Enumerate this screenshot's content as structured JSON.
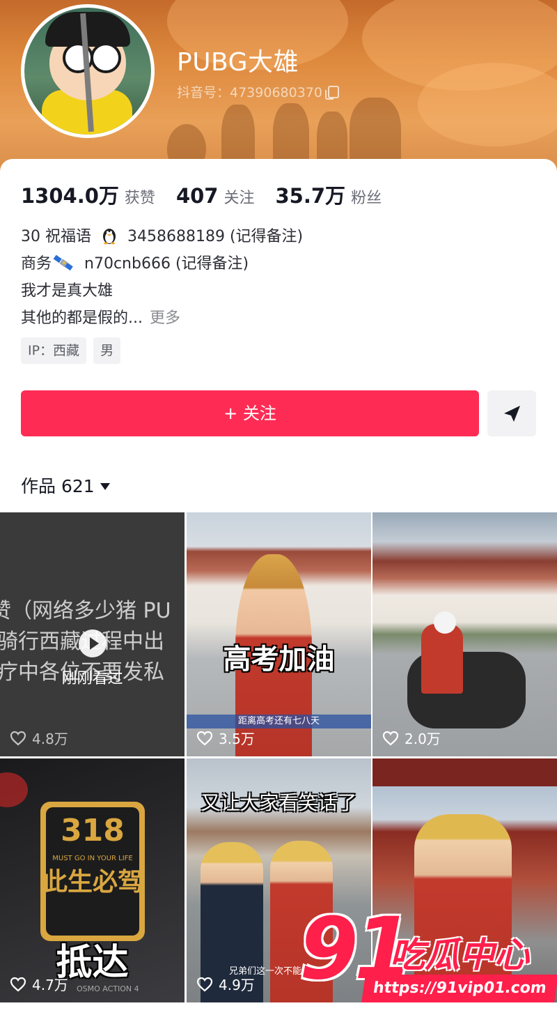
{
  "profile": {
    "nickname": "PUBG大雄",
    "douyin_id": "抖音号：47390680370"
  },
  "stats": [
    {
      "value": "1304.0万",
      "label": "获赞"
    },
    {
      "value": "407",
      "label": "关注"
    },
    {
      "value": "35.7万",
      "label": "粉丝"
    }
  ],
  "bio": {
    "line1_a": "30 祝福语",
    "line1_b": "3458688189 (记得备注)",
    "line2_a": "商务",
    "line2_b": "n70cnb666 (记得备注)",
    "line3": "我才是真大雄",
    "line4": "其他的都是假的...",
    "more": "更多"
  },
  "tags": [
    "IP：西藏",
    "男"
  ],
  "actions": {
    "follow": "+ 关注"
  },
  "works": {
    "label": "作品",
    "count": "621"
  },
  "videos": [
    {
      "likes": "4.8万",
      "overlay_lines": [
        "赞（网络多少猪 PU",
        "骑行西藏过程中出",
        "疗中各位不要发私"
      ],
      "watched_label": "刚刚看过"
    },
    {
      "likes": "3.5万",
      "caption": "高考加油",
      "subtitle": "距离高考还有七八天"
    },
    {
      "likes": "2.0万"
    },
    {
      "likes": "4.7万",
      "caption": "抵达",
      "plate_top": "318",
      "plate_mid": "MUST GO IN YOUR LIFE",
      "plate_bottom": "此生必驾",
      "cam": "OSMO ACTION 4"
    },
    {
      "likes": "4.9万",
      "caption": "又让大家看笑话了",
      "subtitle": "兄弟们这一次不能让大家"
    },
    {
      "likes": ""
    }
  ],
  "watermark": {
    "number": "91",
    "text": "吃瓜中心",
    "url": "https://91vip01.com"
  },
  "colors": {
    "accent": "#fe2c55",
    "banner": "#de8a3e"
  }
}
